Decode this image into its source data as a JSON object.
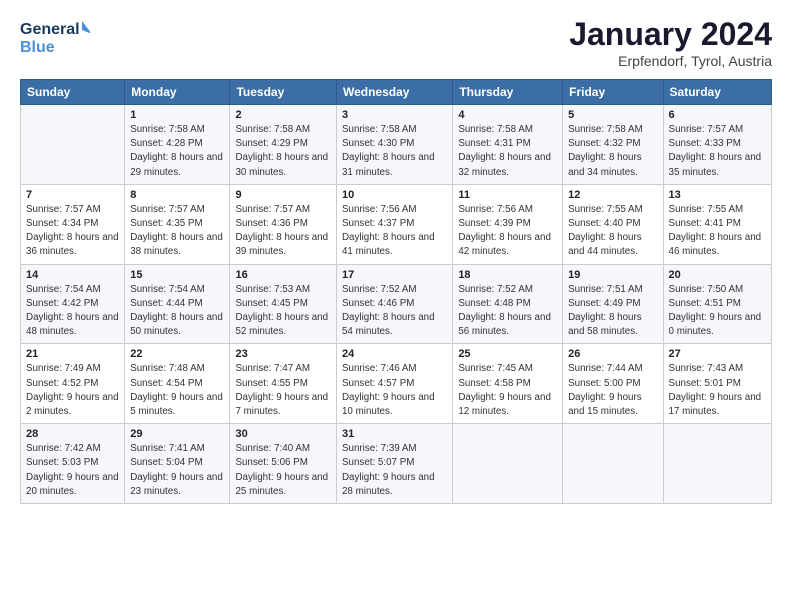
{
  "logo": {
    "line1": "General",
    "line2": "Blue"
  },
  "title": "January 2024",
  "subtitle": "Erpfendorf, Tyrol, Austria",
  "days_of_week": [
    "Sunday",
    "Monday",
    "Tuesday",
    "Wednesday",
    "Thursday",
    "Friday",
    "Saturday"
  ],
  "weeks": [
    [
      {
        "day": "",
        "sunrise": "",
        "sunset": "",
        "daylight": ""
      },
      {
        "day": "1",
        "sunrise": "Sunrise: 7:58 AM",
        "sunset": "Sunset: 4:28 PM",
        "daylight": "Daylight: 8 hours and 29 minutes."
      },
      {
        "day": "2",
        "sunrise": "Sunrise: 7:58 AM",
        "sunset": "Sunset: 4:29 PM",
        "daylight": "Daylight: 8 hours and 30 minutes."
      },
      {
        "day": "3",
        "sunrise": "Sunrise: 7:58 AM",
        "sunset": "Sunset: 4:30 PM",
        "daylight": "Daylight: 8 hours and 31 minutes."
      },
      {
        "day": "4",
        "sunrise": "Sunrise: 7:58 AM",
        "sunset": "Sunset: 4:31 PM",
        "daylight": "Daylight: 8 hours and 32 minutes."
      },
      {
        "day": "5",
        "sunrise": "Sunrise: 7:58 AM",
        "sunset": "Sunset: 4:32 PM",
        "daylight": "Daylight: 8 hours and 34 minutes."
      },
      {
        "day": "6",
        "sunrise": "Sunrise: 7:57 AM",
        "sunset": "Sunset: 4:33 PM",
        "daylight": "Daylight: 8 hours and 35 minutes."
      }
    ],
    [
      {
        "day": "7",
        "sunrise": "Sunrise: 7:57 AM",
        "sunset": "Sunset: 4:34 PM",
        "daylight": "Daylight: 8 hours and 36 minutes."
      },
      {
        "day": "8",
        "sunrise": "Sunrise: 7:57 AM",
        "sunset": "Sunset: 4:35 PM",
        "daylight": "Daylight: 8 hours and 38 minutes."
      },
      {
        "day": "9",
        "sunrise": "Sunrise: 7:57 AM",
        "sunset": "Sunset: 4:36 PM",
        "daylight": "Daylight: 8 hours and 39 minutes."
      },
      {
        "day": "10",
        "sunrise": "Sunrise: 7:56 AM",
        "sunset": "Sunset: 4:37 PM",
        "daylight": "Daylight: 8 hours and 41 minutes."
      },
      {
        "day": "11",
        "sunrise": "Sunrise: 7:56 AM",
        "sunset": "Sunset: 4:39 PM",
        "daylight": "Daylight: 8 hours and 42 minutes."
      },
      {
        "day": "12",
        "sunrise": "Sunrise: 7:55 AM",
        "sunset": "Sunset: 4:40 PM",
        "daylight": "Daylight: 8 hours and 44 minutes."
      },
      {
        "day": "13",
        "sunrise": "Sunrise: 7:55 AM",
        "sunset": "Sunset: 4:41 PM",
        "daylight": "Daylight: 8 hours and 46 minutes."
      }
    ],
    [
      {
        "day": "14",
        "sunrise": "Sunrise: 7:54 AM",
        "sunset": "Sunset: 4:42 PM",
        "daylight": "Daylight: 8 hours and 48 minutes."
      },
      {
        "day": "15",
        "sunrise": "Sunrise: 7:54 AM",
        "sunset": "Sunset: 4:44 PM",
        "daylight": "Daylight: 8 hours and 50 minutes."
      },
      {
        "day": "16",
        "sunrise": "Sunrise: 7:53 AM",
        "sunset": "Sunset: 4:45 PM",
        "daylight": "Daylight: 8 hours and 52 minutes."
      },
      {
        "day": "17",
        "sunrise": "Sunrise: 7:52 AM",
        "sunset": "Sunset: 4:46 PM",
        "daylight": "Daylight: 8 hours and 54 minutes."
      },
      {
        "day": "18",
        "sunrise": "Sunrise: 7:52 AM",
        "sunset": "Sunset: 4:48 PM",
        "daylight": "Daylight: 8 hours and 56 minutes."
      },
      {
        "day": "19",
        "sunrise": "Sunrise: 7:51 AM",
        "sunset": "Sunset: 4:49 PM",
        "daylight": "Daylight: 8 hours and 58 minutes."
      },
      {
        "day": "20",
        "sunrise": "Sunrise: 7:50 AM",
        "sunset": "Sunset: 4:51 PM",
        "daylight": "Daylight: 9 hours and 0 minutes."
      }
    ],
    [
      {
        "day": "21",
        "sunrise": "Sunrise: 7:49 AM",
        "sunset": "Sunset: 4:52 PM",
        "daylight": "Daylight: 9 hours and 2 minutes."
      },
      {
        "day": "22",
        "sunrise": "Sunrise: 7:48 AM",
        "sunset": "Sunset: 4:54 PM",
        "daylight": "Daylight: 9 hours and 5 minutes."
      },
      {
        "day": "23",
        "sunrise": "Sunrise: 7:47 AM",
        "sunset": "Sunset: 4:55 PM",
        "daylight": "Daylight: 9 hours and 7 minutes."
      },
      {
        "day": "24",
        "sunrise": "Sunrise: 7:46 AM",
        "sunset": "Sunset: 4:57 PM",
        "daylight": "Daylight: 9 hours and 10 minutes."
      },
      {
        "day": "25",
        "sunrise": "Sunrise: 7:45 AM",
        "sunset": "Sunset: 4:58 PM",
        "daylight": "Daylight: 9 hours and 12 minutes."
      },
      {
        "day": "26",
        "sunrise": "Sunrise: 7:44 AM",
        "sunset": "Sunset: 5:00 PM",
        "daylight": "Daylight: 9 hours and 15 minutes."
      },
      {
        "day": "27",
        "sunrise": "Sunrise: 7:43 AM",
        "sunset": "Sunset: 5:01 PM",
        "daylight": "Daylight: 9 hours and 17 minutes."
      }
    ],
    [
      {
        "day": "28",
        "sunrise": "Sunrise: 7:42 AM",
        "sunset": "Sunset: 5:03 PM",
        "daylight": "Daylight: 9 hours and 20 minutes."
      },
      {
        "day": "29",
        "sunrise": "Sunrise: 7:41 AM",
        "sunset": "Sunset: 5:04 PM",
        "daylight": "Daylight: 9 hours and 23 minutes."
      },
      {
        "day": "30",
        "sunrise": "Sunrise: 7:40 AM",
        "sunset": "Sunset: 5:06 PM",
        "daylight": "Daylight: 9 hours and 25 minutes."
      },
      {
        "day": "31",
        "sunrise": "Sunrise: 7:39 AM",
        "sunset": "Sunset: 5:07 PM",
        "daylight": "Daylight: 9 hours and 28 minutes."
      },
      {
        "day": "",
        "sunrise": "",
        "sunset": "",
        "daylight": ""
      },
      {
        "day": "",
        "sunrise": "",
        "sunset": "",
        "daylight": ""
      },
      {
        "day": "",
        "sunrise": "",
        "sunset": "",
        "daylight": ""
      }
    ]
  ]
}
